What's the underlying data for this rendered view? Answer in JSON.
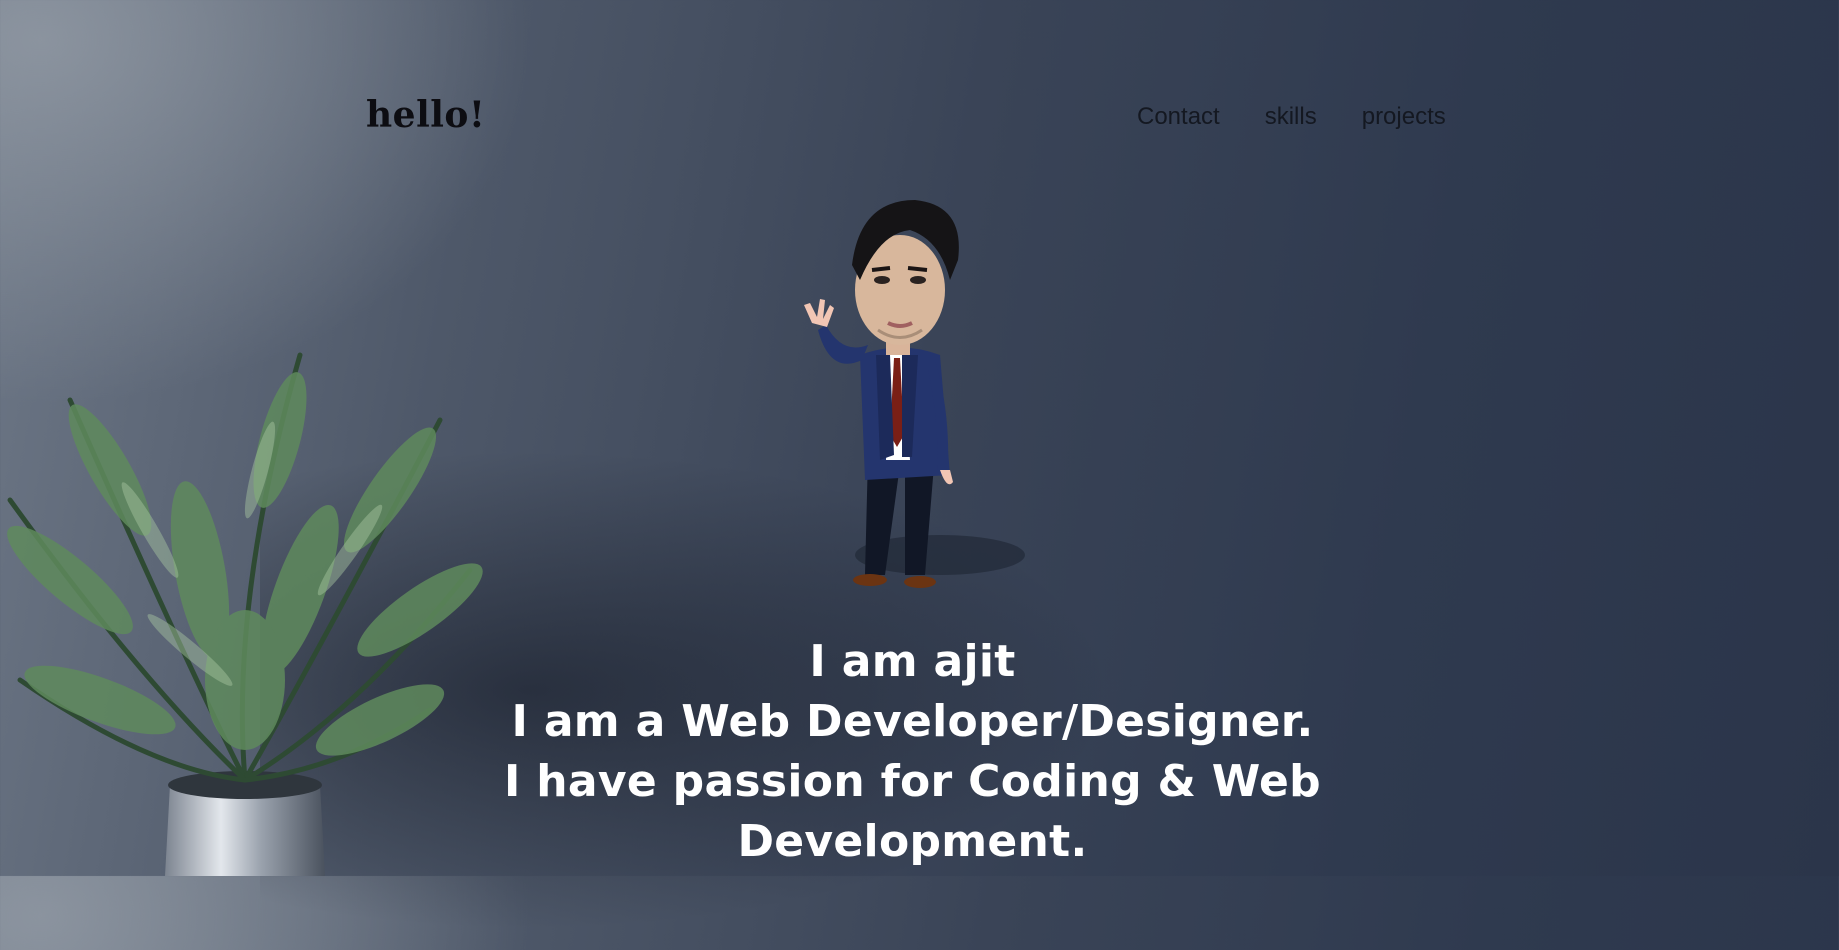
{
  "header": {
    "logo": "hello!",
    "nav": [
      {
        "label": "Contact"
      },
      {
        "label": "skills"
      },
      {
        "label": "projects"
      }
    ]
  },
  "hero": {
    "lines": [
      "I am ajit",
      "I am a Web Developer/Designer.",
      "I have passion for Coding & Web Development."
    ]
  },
  "colors": {
    "text_light": "#ffffff",
    "nav_text": "#141821",
    "background_dark": "#2b354a"
  },
  "images": {
    "avatar": "cartoon-avatar-man-in-suit",
    "decor": "potted-palm-plant"
  }
}
